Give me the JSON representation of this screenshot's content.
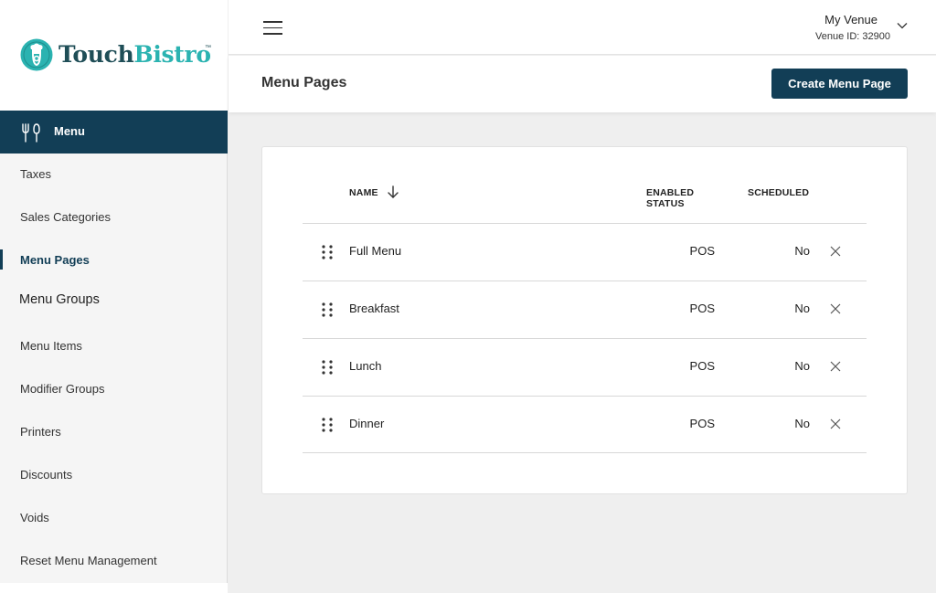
{
  "brand": {
    "name_part1": "Touch",
    "name_part2": "Bistro",
    "primary_color": "#123e56",
    "accent_color": "#2bb3b1",
    "logo_icon": "touchbistro-chef-icon"
  },
  "sidebar": {
    "active_section": {
      "label": "Menu",
      "icon": "fork-knife-icon"
    },
    "items": [
      {
        "label": "Taxes"
      },
      {
        "label": "Sales Categories"
      },
      {
        "label": "Menu Pages",
        "current": true
      },
      {
        "label": "Menu Groups"
      },
      {
        "label": "Menu Items"
      },
      {
        "label": "Modifier Groups"
      },
      {
        "label": "Printers"
      },
      {
        "label": "Discounts"
      },
      {
        "label": "Voids"
      },
      {
        "label": "Reset Menu Management"
      }
    ]
  },
  "topbar": {
    "menu_icon": "hamburger-icon",
    "venue_name": "My Venue",
    "venue_id": "Venue ID: 32900",
    "venue_dropdown_icon": "chevron-down-icon"
  },
  "page": {
    "title": "Menu Pages",
    "create_button": "Create Menu Page"
  },
  "table": {
    "columns": {
      "name": "NAME",
      "enabled_status_line1": "ENABLED",
      "enabled_status_line2": "STATUS",
      "scheduled": "SCHEDULED"
    },
    "sort": {
      "column": "name",
      "direction": "descending",
      "icon": "arrow-down-icon"
    },
    "rows": [
      {
        "name": "Full Menu",
        "enabled_status": "POS",
        "scheduled": "No"
      },
      {
        "name": "Breakfast",
        "enabled_status": "POS",
        "scheduled": "No"
      },
      {
        "name": "Lunch",
        "enabled_status": "POS",
        "scheduled": "No"
      },
      {
        "name": "Dinner",
        "enabled_status": "POS",
        "scheduled": "No"
      }
    ]
  }
}
